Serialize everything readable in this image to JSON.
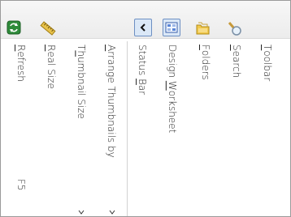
{
  "toolbar": {
    "buttons": [
      {
        "name": "refresh",
        "icon": "refresh-icon"
      },
      {
        "name": "real-size",
        "icon": "ruler-icon"
      },
      {
        "name": "status-bar",
        "icon": "chevron-left-icon",
        "pressed": true
      },
      {
        "name": "design-worksheet",
        "icon": "worksheet-icon",
        "pressed": true
      },
      {
        "name": "folders",
        "icon": "folders-icon"
      },
      {
        "name": "search",
        "icon": "magnifier-icon"
      }
    ]
  },
  "menu": {
    "refresh": {
      "pre": "",
      "mn": "R",
      "post": "efresh",
      "accel": "F5"
    },
    "real_size": {
      "pre": "",
      "mn": "R",
      "post": "eal Size"
    },
    "thumbnail_size": {
      "pre": "T",
      "mn": "h",
      "post": "umbnail Size"
    },
    "arrange_thumbnails": {
      "pre": "",
      "mn": "A",
      "post": "rrange Thumbnails by"
    },
    "status_bar": {
      "pre": "Status ",
      "mn": "B",
      "post": "ar"
    },
    "design_worksheet": {
      "pre": "Design ",
      "mn": "W",
      "post": "orksheet"
    },
    "folders": {
      "pre": "",
      "mn": "F",
      "post": "olders"
    },
    "search": {
      "pre": "",
      "mn": "S",
      "post": "earch"
    },
    "toolbar": {
      "pre": "",
      "mn": "T",
      "post": "oolbar"
    }
  },
  "colors": {
    "pressed_bg": "#dbe8f7",
    "pressed_border": "#6d8fc3",
    "text": "#222222"
  }
}
